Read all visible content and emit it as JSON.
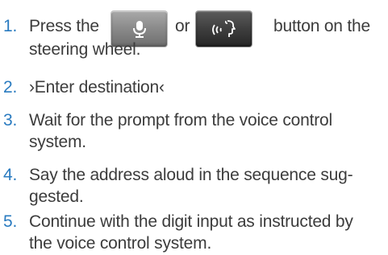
{
  "steps": [
    {
      "number": "1.",
      "before": "Press the",
      "between": "or",
      "after": "button on the",
      "line2": "steering wheel.",
      "buttons": [
        {
          "icon": "microphone-icon",
          "style": "light-gray"
        },
        {
          "icon": "voice-command-icon",
          "style": "dark-gray"
        }
      ]
    },
    {
      "number": "2.",
      "lines": [
        "›Enter destination‹"
      ]
    },
    {
      "number": "3.",
      "lines": [
        "Wait for the prompt from the voice control",
        "system."
      ]
    },
    {
      "number": "4.",
      "lines": [
        "Say the address aloud in the sequence sug-",
        "gested."
      ]
    },
    {
      "number": "5.",
      "lines": [
        "Continue with the digit input as instructed by",
        "the voice control system."
      ]
    }
  ],
  "colors": {
    "step_number": "#2a7bc0",
    "text": "#3c3c3c"
  }
}
